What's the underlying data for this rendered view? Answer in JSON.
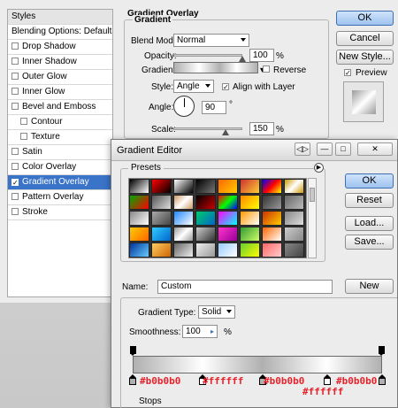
{
  "layer_style": {
    "styles_panel": {
      "header": "Styles",
      "blending": "Blending Options: Default",
      "items": [
        {
          "label": "Drop Shadow",
          "checked": false
        },
        {
          "label": "Inner Shadow",
          "checked": false
        },
        {
          "label": "Outer Glow",
          "checked": false
        },
        {
          "label": "Inner Glow",
          "checked": false
        },
        {
          "label": "Bevel and Emboss",
          "checked": false
        },
        {
          "label": "Contour",
          "checked": false
        },
        {
          "label": "Texture",
          "checked": false
        },
        {
          "label": "Satin",
          "checked": false
        },
        {
          "label": "Color Overlay",
          "checked": false
        },
        {
          "label": "Gradient Overlay",
          "checked": true,
          "selected": true
        },
        {
          "label": "Pattern Overlay",
          "checked": false
        },
        {
          "label": "Stroke",
          "checked": false
        }
      ]
    },
    "section_title": "Gradient Overlay",
    "group_title": "Gradient",
    "blend_mode": {
      "label": "Blend Mode:",
      "value": "Normal"
    },
    "opacity": {
      "label": "Opacity:",
      "value": "100",
      "unit": "%",
      "level": 1.0
    },
    "gradient": {
      "label": "Gradient:"
    },
    "reverse": {
      "label": "Reverse",
      "checked": false
    },
    "style": {
      "label": "Style:",
      "value": "Angle"
    },
    "align_with_layer": {
      "label": "Align with Layer",
      "checked": true
    },
    "angle": {
      "label": "Angle:",
      "value": "90",
      "unit": "°"
    },
    "scale": {
      "label": "Scale:",
      "value": "150",
      "unit": "%",
      "level": 0.75
    },
    "buttons": {
      "ok": "OK",
      "cancel": "Cancel",
      "new_style": "New Style..."
    },
    "preview": {
      "label": "Preview",
      "checked": true
    }
  },
  "gradient_editor": {
    "title": "Gradient Editor",
    "window_buttons": [
      "◁▷",
      "—",
      "□",
      "✕"
    ],
    "presets_title": "Presets",
    "presets_menu_icon": "▶",
    "buttons": {
      "ok": "OK",
      "reset": "Reset",
      "load": "Load...",
      "save": "Save...",
      "new": "New"
    },
    "name": {
      "label": "Name:",
      "value": "Custom"
    },
    "gradient_type": {
      "label": "Gradient Type:",
      "value": "Solid"
    },
    "smoothness": {
      "label": "Smoothness:",
      "value": "100",
      "unit": "%"
    },
    "color_stops": [
      {
        "color": "#b0b0b0",
        "location": 0
      },
      {
        "color": "#ffffff",
        "location": 28
      },
      {
        "color": "#b0b0b0",
        "location": 52
      },
      {
        "color": "#ffffff",
        "location": 78
      },
      {
        "color": "#b0b0b0",
        "location": 100
      }
    ],
    "stop_labels": {
      "a": "#b0b0b0",
      "b": "#ffffff",
      "c": "#b0b0b0",
      "d": "#ffffff",
      "e": "#b0b0b0"
    },
    "stops_group": "Stops"
  }
}
